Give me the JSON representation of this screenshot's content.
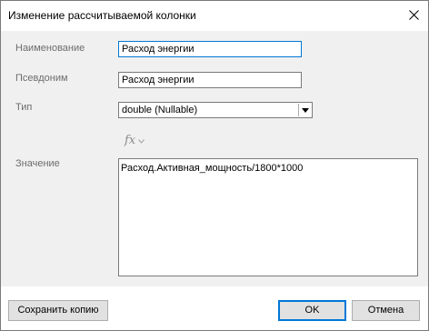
{
  "window": {
    "title": "Изменение рассчитываемой колонки",
    "close_icon": "close-icon"
  },
  "form": {
    "name_label": "Наименование",
    "name_value": "Расход энергии",
    "alias_label": "Псевдоним",
    "alias_value": "Расход энергии",
    "type_label": "Тип",
    "type_value": "double (Nullable)",
    "fx_label": "fx",
    "value_label": "Значение",
    "value_text": "Расход.Активная_мощность/1800*1000"
  },
  "buttons": {
    "save_copy": "Сохранить копию",
    "ok": "OK",
    "cancel": "Отмена"
  },
  "colors": {
    "accent": "#0078d7",
    "content_bg": "#f0f0f0"
  }
}
